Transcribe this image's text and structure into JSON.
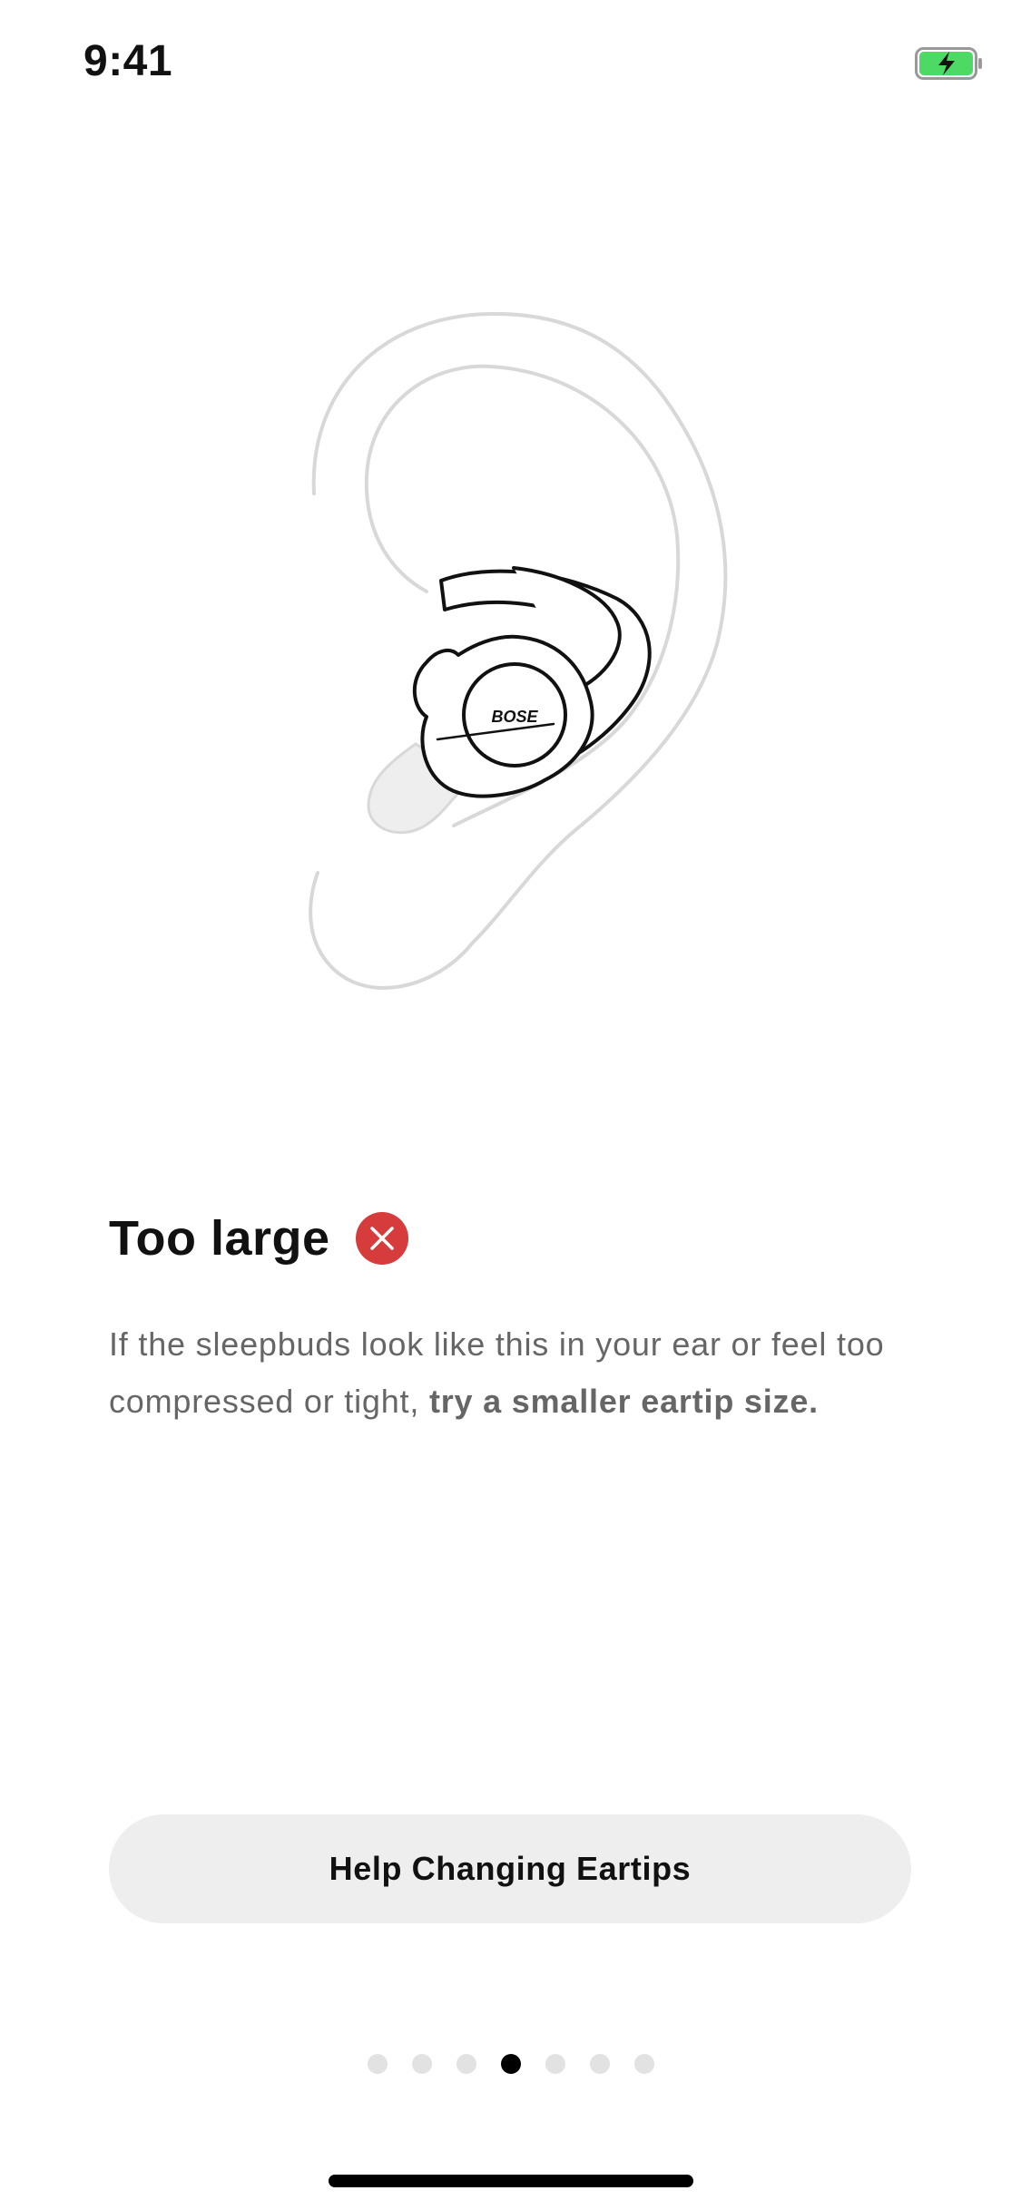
{
  "status_bar": {
    "time": "9:41",
    "battery_color": "#4cd964"
  },
  "illustration": {
    "brand_mark": "BOSE"
  },
  "fit_result": {
    "title": "Too large",
    "status_icon": "x-circle-icon",
    "status_color": "#d63c3c",
    "description_plain": "If the sleepbuds look like this in your ear or feel too compressed or tight, ",
    "description_bold": "try a smaller eartip size."
  },
  "help_button": {
    "label": "Help Changing Eartips"
  },
  "pager": {
    "total_pages": 7,
    "current_page": 4
  }
}
